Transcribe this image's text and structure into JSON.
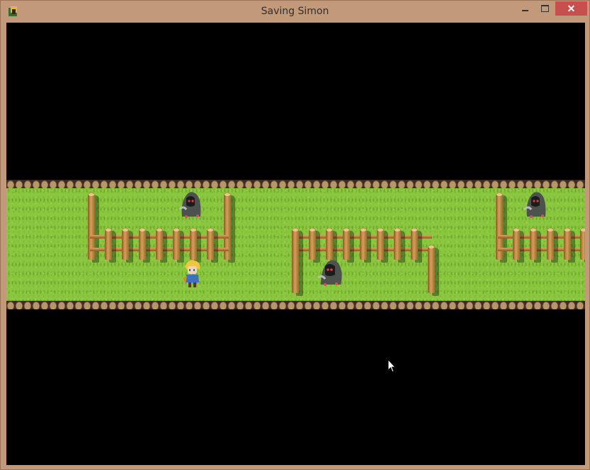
{
  "window": {
    "title": "Saving Simon",
    "controls": {
      "minimize": "",
      "maximize": "",
      "close": "✕"
    }
  },
  "game": {
    "scene": "grass-corridor",
    "characters": [
      {
        "name": "player-hero",
        "kind": "hero"
      },
      {
        "name": "hooded-ghost-1",
        "kind": "ghost"
      },
      {
        "name": "hooded-ghost-2",
        "kind": "ghost"
      },
      {
        "name": "hooded-ghost-3",
        "kind": "ghost"
      }
    ],
    "colors": {
      "grass": "#8bc63f",
      "void": "#000000",
      "wood": "#c48a45",
      "chrome": "#c39a79",
      "close": "#c7504e"
    }
  }
}
